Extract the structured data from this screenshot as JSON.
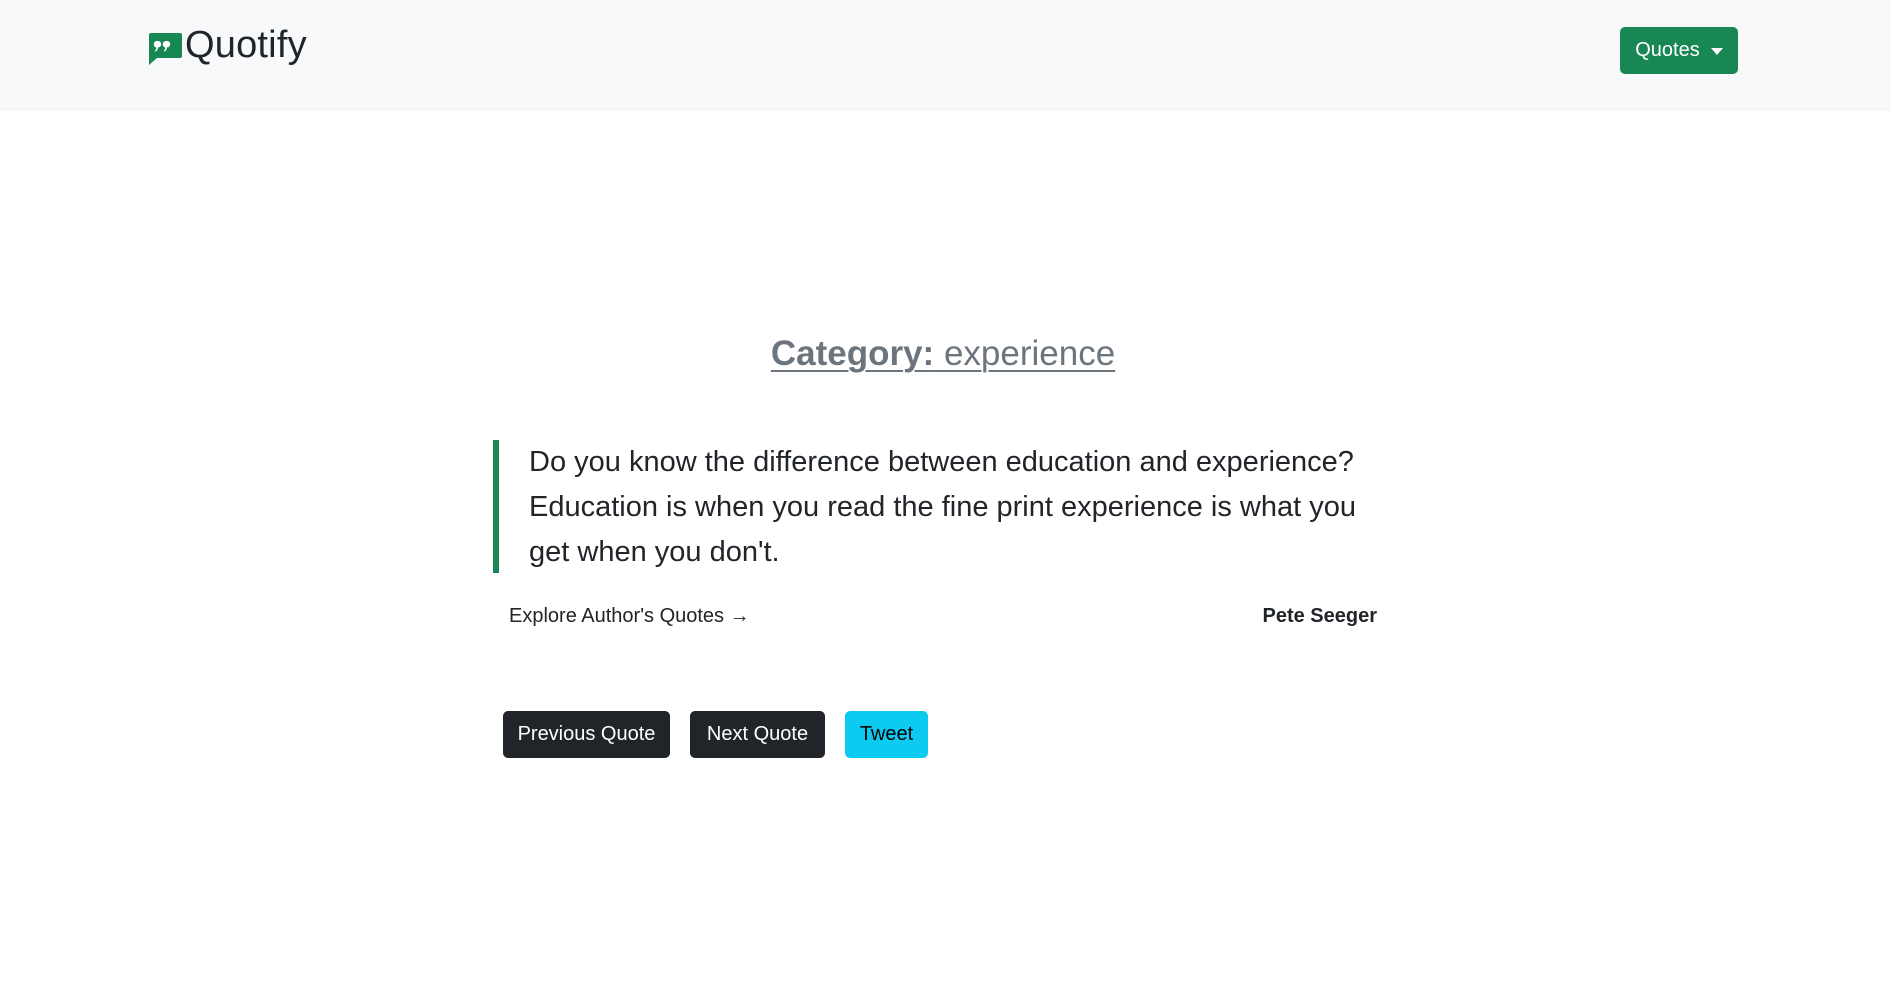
{
  "brand": {
    "icon": "quote-bubble-icon",
    "name": "Quotify"
  },
  "nav": {
    "dropdown_label": "Quotes",
    "dropdown_icon": "caret-down-icon"
  },
  "category": {
    "label": "Category:",
    "value": "experience"
  },
  "quote": {
    "text": "Do you know the difference between education and experience? Education is when you read the fine print experience is what you get when you don't.",
    "author": "Pete Seeger",
    "explore_link": "Explore Author's Quotes →"
  },
  "actions": {
    "previous_label": "Previous Quote",
    "next_label": "Next Quote",
    "tweet_label": "Tweet"
  },
  "colors": {
    "primary": "#198754",
    "dark": "#212529",
    "info": "#0dcaf0",
    "muted": "#6c757d",
    "navbar_bg": "#f8f9fa"
  }
}
